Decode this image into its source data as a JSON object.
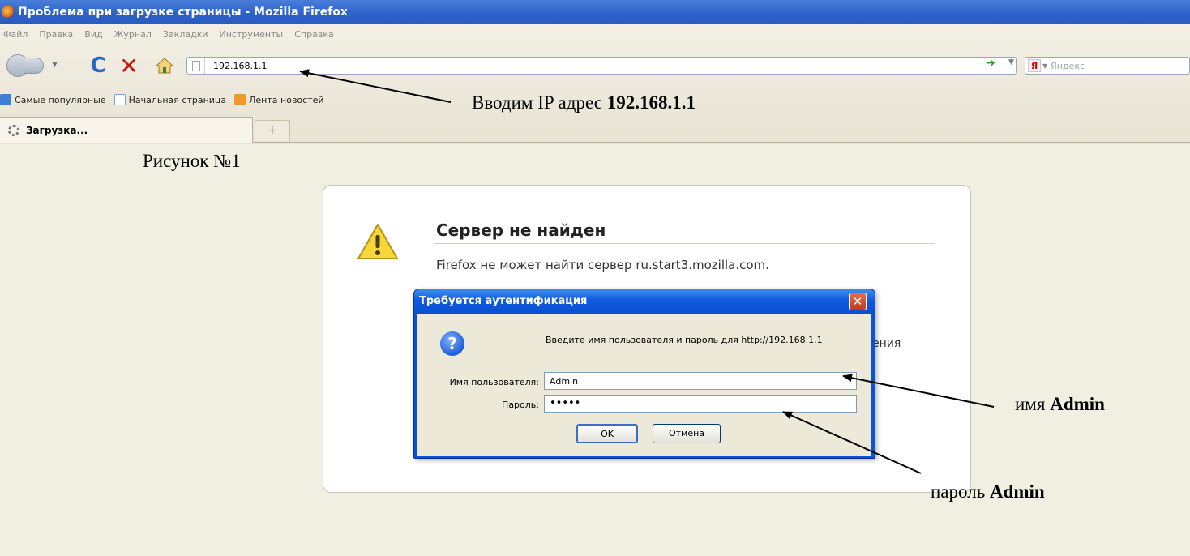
{
  "window": {
    "title": "Проблема при загрузке страницы - Mozilla Firefox"
  },
  "menubar": {
    "items": [
      "Файл",
      "Правка",
      "Вид",
      "Журнал",
      "Закладки",
      "Инструменты",
      "Справка"
    ]
  },
  "navbar": {
    "url": "192.168.1.1",
    "search_placeholder": "Яндекс",
    "search_engine_badge": "Я"
  },
  "bookmarks": {
    "items": [
      "Самые популярные",
      "Начальная страница",
      "Лента новостей"
    ]
  },
  "tabs": {
    "active_label": "Загрузка...",
    "new_tab_symbol": "+"
  },
  "error_page": {
    "title": "Сервер не найден",
    "message": "Firefox не может найти сервер ru.start3.mozilla.com.",
    "partial_text": "ения"
  },
  "auth_dialog": {
    "title": "Требуется аутентификация",
    "prompt": "Введите имя пользователя и пароль для http://192.168.1.1",
    "username_label": "Имя пользователя:",
    "username_value": "Admin",
    "password_label": "Пароль:",
    "password_value": "•••••",
    "ok_label": "OK",
    "cancel_label": "Отмена",
    "close_symbol": "✕",
    "question_symbol": "?"
  },
  "annotations": {
    "figure_label": "Рисунок  №1",
    "ip_note_prefix": "Вводим IP адрес ",
    "ip_note_value": "192.168.1.1",
    "user_note_prefix": "имя ",
    "user_note_value": "Admin",
    "pass_note_prefix": "пароль ",
    "pass_note_value": "Admin"
  },
  "colors": {
    "titlebar": "#2e62c9",
    "dialog_frame": "#0b52d6",
    "page_background": "#f1eee2"
  }
}
